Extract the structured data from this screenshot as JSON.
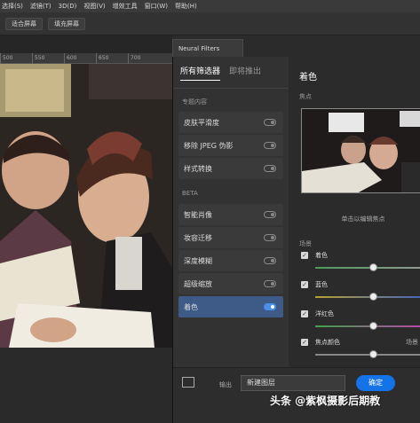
{
  "menubar": [
    "选择(S)",
    "滤镜(T)",
    "3D(D)",
    "视图(V)",
    "增效工具",
    "窗口(W)",
    "帮助(H)"
  ],
  "options_bar": {
    "fit_screen": "适合屏幕",
    "fill_screen": "填充屏幕"
  },
  "ruler": [
    "500",
    "550",
    "600",
    "650",
    "700"
  ],
  "panel": {
    "window_tab": "Neural Filters",
    "tab_all": "所有筛选器",
    "tab_waitlist": "即将推出",
    "section_featured": "专题内容",
    "section_beta": "BETA",
    "featured": [
      {
        "label": "皮肤平滑度",
        "on": false
      },
      {
        "label": "移除 JPEG 伪影",
        "on": false
      },
      {
        "label": "样式转换",
        "on": false
      }
    ],
    "beta": [
      {
        "label": "智能肖像",
        "on": false
      },
      {
        "label": "妆容迁移",
        "on": false
      },
      {
        "label": "深度模糊",
        "on": false
      },
      {
        "label": "超级缩放",
        "on": false
      },
      {
        "label": "着色",
        "on": true
      }
    ],
    "right_title": "着色",
    "focus_label": "焦点",
    "hint": "单击以编辑焦点",
    "scene_label": "场景",
    "rows": [
      {
        "label": "着色",
        "value": 0.5
      },
      {
        "label": "蓝色",
        "value": 0.5
      },
      {
        "label": "洋红色",
        "value": 0.5
      },
      {
        "label": "焦点颜色",
        "value": 0.5
      }
    ],
    "scene_right": "场景"
  },
  "footer": {
    "output_label": "输出",
    "output_value": "新建图层",
    "ok": "确定",
    "cancel": "取"
  },
  "watermark": "头条 @紫枫摄影后期教",
  "colors": {
    "accent": "#1473e6",
    "selected": "#3e5a87"
  }
}
